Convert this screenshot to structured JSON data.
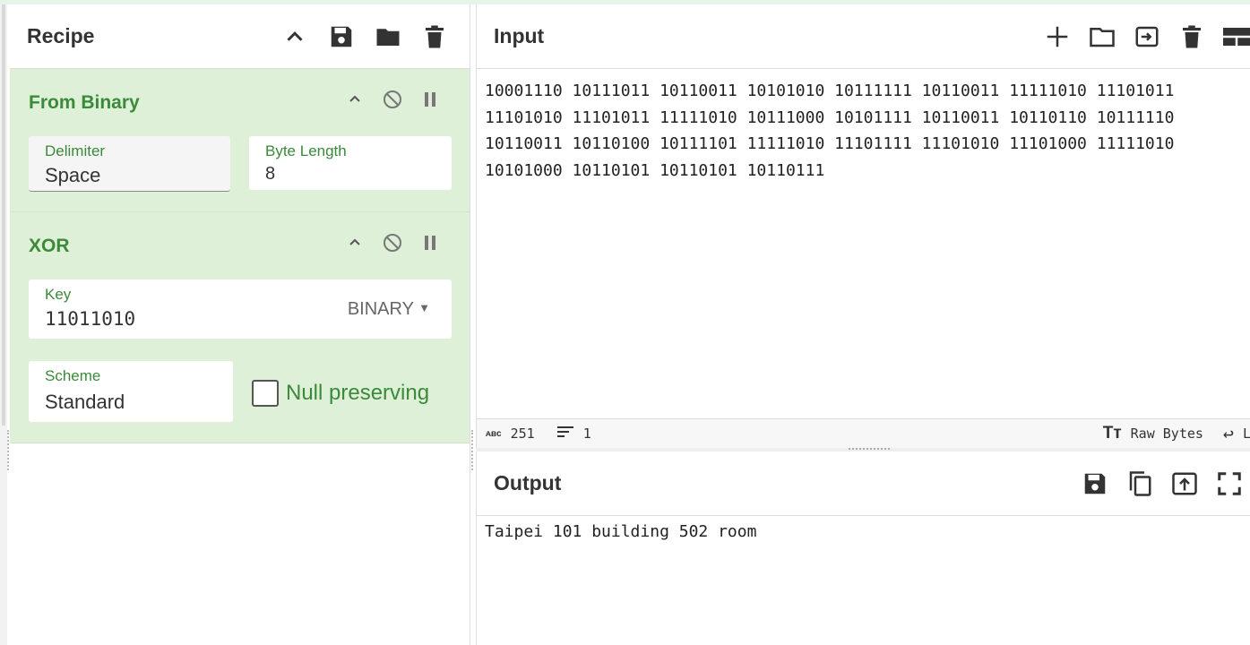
{
  "recipe": {
    "title": "Recipe",
    "operations": [
      {
        "name": "From Binary",
        "fields": [
          {
            "label": "Delimiter",
            "value": "Space"
          },
          {
            "label": "Byte Length",
            "value": "8"
          }
        ]
      },
      {
        "name": "XOR",
        "key": {
          "label": "Key",
          "value": "11011010",
          "format": "BINARY"
        },
        "scheme": {
          "label": "Scheme",
          "value": "Standard"
        },
        "null_preserving": {
          "label": "Null preserving",
          "checked": false
        }
      }
    ]
  },
  "input": {
    "title": "Input",
    "lines": [
      "10001110 10111011 10110011 10101010 10111111 10110011 11111010 11101011",
      "11101010 11101011 11111010 10111000 10101111 10110011 10110110 10111110",
      "10110011 10110100 10111101 11111010 11101111 11101010 11101000 11111010",
      "10101000 10110101 10110101 10110111"
    ],
    "status": {
      "char_count": "251",
      "line_count": "1",
      "encoding": "Raw Bytes",
      "eol_abbrev": "L"
    }
  },
  "output": {
    "title": "Output",
    "text": "Taipei 101 building 502 room"
  }
}
